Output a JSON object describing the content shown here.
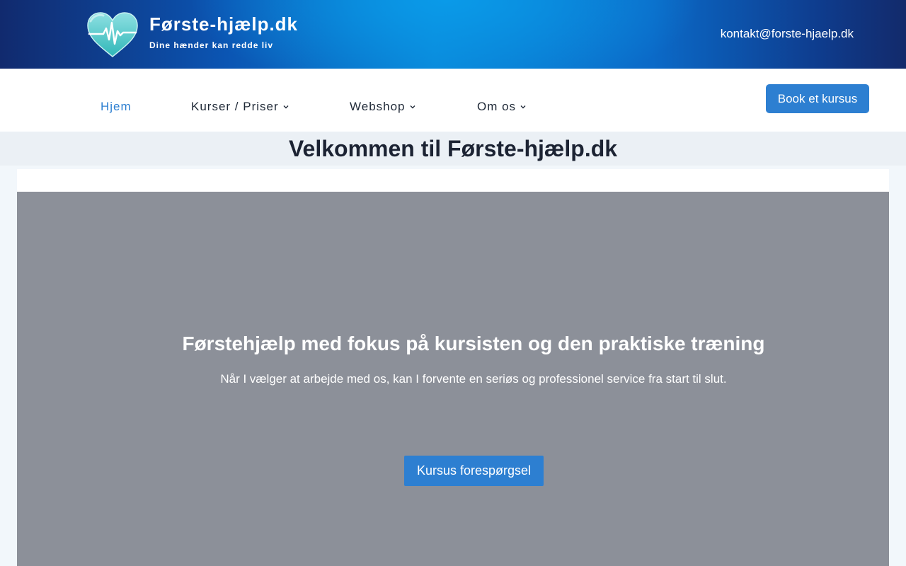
{
  "header": {
    "logo_icon": "heart-pulse-icon",
    "site_title": "Første-hjælp.dk",
    "tagline": "Dine hænder kan redde liv",
    "contact_email": "kontakt@forste-hjaelp.dk"
  },
  "nav": {
    "items": [
      {
        "label": "Hjem",
        "active": true
      },
      {
        "label": "Kurser / Priser",
        "has_dropdown": true
      },
      {
        "label": "Webshop",
        "has_dropdown": true
      },
      {
        "label": "Om os",
        "has_dropdown": true
      }
    ],
    "book_button": "Book et kursus"
  },
  "page": {
    "title": "Velkommen til Første-hjælp.dk"
  },
  "hero": {
    "heading": "Førstehjælp med fokus på kursisten og den praktiske træning",
    "text": "Når I vælger at arbejde med os, kan I forvente en seriøs og professionel service fra start til slut.",
    "cta": "Kursus forespørgsel"
  },
  "colors": {
    "accent": "#2d7fd1",
    "banner_dark": "#112a6e",
    "banner_light": "#0a9ae8",
    "hero_overlay": "#8c9099",
    "title_strip": "#ebf0f5"
  }
}
